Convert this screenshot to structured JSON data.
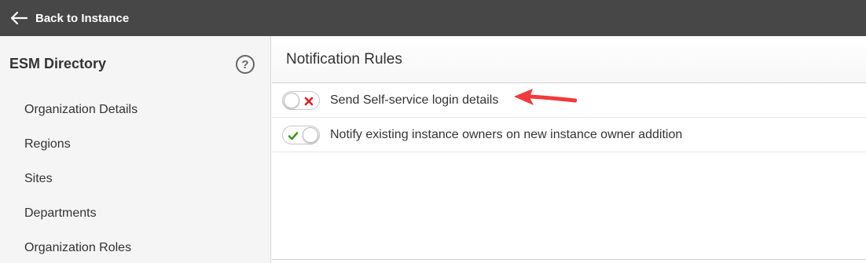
{
  "topbar": {
    "back_label": "Back to Instance",
    "back_icon": "arrow-left-icon",
    "background_color": "#474747"
  },
  "sidebar": {
    "title": "ESM Directory",
    "help_symbol": "?",
    "items": [
      {
        "label": "Organization Details"
      },
      {
        "label": "Regions"
      },
      {
        "label": "Sites"
      },
      {
        "label": "Departments"
      },
      {
        "label": "Organization Roles"
      }
    ]
  },
  "main": {
    "title": "Notification Rules",
    "rules": [
      {
        "label": "Send Self-service login details",
        "enabled": false
      },
      {
        "label": "Notify existing instance owners on new instance owner addition",
        "enabled": true
      }
    ]
  },
  "colors": {
    "toggle_off_mark": "#e02020",
    "toggle_on_mark": "#3a9a1a",
    "annotation_arrow": "#ef3b3b"
  }
}
